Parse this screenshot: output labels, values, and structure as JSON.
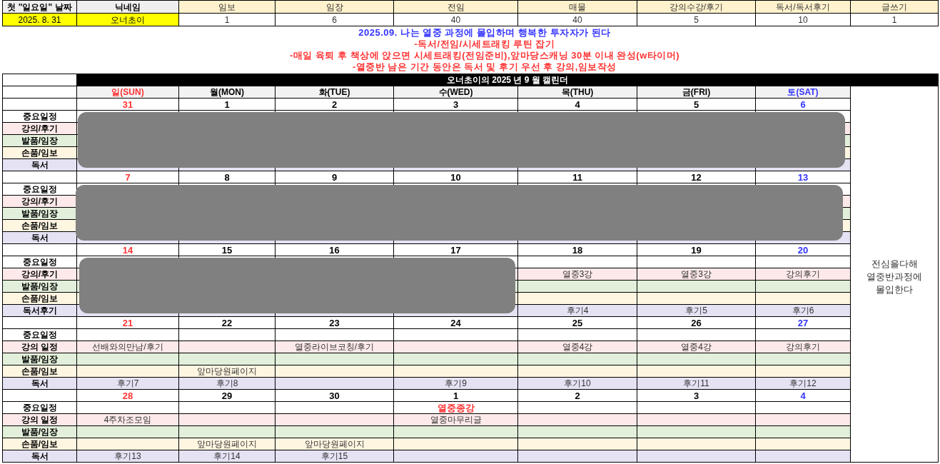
{
  "summary": {
    "headers": [
      "첫 \"일요일\" 날짜",
      "닉네임",
      "임보",
      "임장",
      "전임",
      "매물",
      "강의수강/후기",
      "독서/독서후기",
      "글쓰기"
    ],
    "values": [
      "2025. 8. 31",
      "오너초이",
      "1",
      "6",
      "40",
      "40",
      "5",
      "10",
      "1"
    ]
  },
  "goals": [
    {
      "text": "2025.09. 나는 열중 과정에 몰입하며 행복한 투자자가 된다",
      "kind": "headline"
    },
    {
      "text": "-독서/전임/시세트래킹 루틴 잡기",
      "kind": "item"
    },
    {
      "text": "-매일 육퇴 후 책상에 앉으면 시세트래킹(전임준비),앞마당스캐닝 30분 이내 완성(w타이머)",
      "kind": "item"
    },
    {
      "text": "-열중반 남은 기간 동안은 독서 및 후기 우선 후 강의,임보작성",
      "kind": "item"
    }
  ],
  "calendar": {
    "title": "오너초이의 2025 년 9 월 캘린더",
    "day_headers": [
      {
        "label": "일(SUN)",
        "kind": "sunday"
      },
      {
        "label": "월(MON)",
        "kind": "weekday"
      },
      {
        "label": "화(TUE)",
        "kind": "weekday"
      },
      {
        "label": "수(WED)",
        "kind": "weekday"
      },
      {
        "label": "목(THU)",
        "kind": "weekday"
      },
      {
        "label": "금(FRI)",
        "kind": "weekday"
      },
      {
        "label": "토(SAT)",
        "kind": "saturday"
      }
    ],
    "side_note": "전심을다해\n열중반과정에\n몰입한다",
    "weeks": [
      {
        "dates": [
          "31",
          "1",
          "2",
          "3",
          "4",
          "5",
          "6"
        ],
        "rows": [
          {
            "label": "중요일정",
            "kind": "important",
            "cells": {}
          },
          {
            "label": "강의/후기",
            "kind": "lecture",
            "cells": {}
          },
          {
            "label": "발품/임장",
            "kind": "field",
            "cells": {}
          },
          {
            "label": "손품/임보",
            "kind": "online",
            "cells": {}
          },
          {
            "label": "독서",
            "kind": "reading",
            "cells": {}
          }
        ]
      },
      {
        "dates": [
          "7",
          "8",
          "9",
          "10",
          "11",
          "12",
          "13"
        ],
        "rows": [
          {
            "label": "중요일정",
            "kind": "important",
            "cells": {}
          },
          {
            "label": "강의/후기",
            "kind": "lecture",
            "cells": {}
          },
          {
            "label": "발품/임장",
            "kind": "field",
            "cells": {}
          },
          {
            "label": "손품/임보",
            "kind": "online",
            "cells": {}
          },
          {
            "label": "독서",
            "kind": "reading",
            "cells": {}
          }
        ]
      },
      {
        "dates": [
          "14",
          "15",
          "16",
          "17",
          "18",
          "19",
          "20"
        ],
        "rows": [
          {
            "label": "중요일정",
            "kind": "important",
            "cells": {}
          },
          {
            "label": "강의/후기",
            "kind": "lecture",
            "cells": {
              "thu": "열중3강",
              "fri": "열중3강",
              "sat": "강의후기"
            }
          },
          {
            "label": "발품/임장",
            "kind": "field",
            "cells": {}
          },
          {
            "label": "손품/임보",
            "kind": "online",
            "cells": {}
          },
          {
            "label": "독서후기",
            "kind": "reading",
            "cells": {
              "thu": "후기4",
              "fri": "후기5",
              "sat": "후기6"
            }
          }
        ]
      },
      {
        "dates": [
          "21",
          "22",
          "23",
          "24",
          "25",
          "26",
          "27"
        ],
        "rows": [
          {
            "label": "중요일정",
            "kind": "important",
            "cells": {}
          },
          {
            "label": "강의 일정",
            "kind": "lecture",
            "cells": {
              "sun": "선배와의만남/후기",
              "tue": "열중라이브코칭/후기",
              "thu": "열중4강",
              "fri": "열중4강",
              "sat": "강의후기"
            }
          },
          {
            "label": "발품/임장",
            "kind": "field",
            "cells": {}
          },
          {
            "label": "손품/임보",
            "kind": "online",
            "cells": {
              "mon": "앞마당원페이지"
            }
          },
          {
            "label": "독서",
            "kind": "reading",
            "cells": {
              "sun": "후기7",
              "mon": "후기8",
              "wed": "후기9",
              "thu": "후기10",
              "fri": "후기11",
              "sat": "후기12"
            }
          }
        ]
      },
      {
        "dates": [
          "28",
          "29",
          "30",
          "1",
          "2",
          "3",
          "4"
        ],
        "rows": [
          {
            "label": "중요일정",
            "kind": "important",
            "cells": {
              "wed": "열중종강"
            }
          },
          {
            "label": "강의 일정",
            "kind": "lecture",
            "cells": {
              "sun": "4주차조모임",
              "wed": "열중마무리글"
            }
          },
          {
            "label": "발품/임장",
            "kind": "field",
            "cells": {}
          },
          {
            "label": "손품/임보",
            "kind": "online",
            "cells": {
              "mon": "앞마당원페이지",
              "tue": "앞마당원페이지"
            }
          },
          {
            "label": "독서",
            "kind": "reading",
            "cells": {
              "sun": "후기13",
              "mon": "후기14",
              "tue": "후기15"
            }
          }
        ]
      }
    ]
  }
}
